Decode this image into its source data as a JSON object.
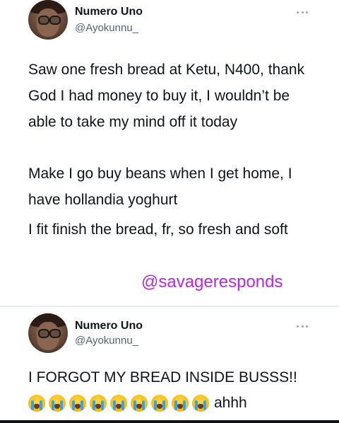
{
  "tweet1": {
    "author_name": "Numero Uno",
    "author_handle": "@Ayokunnu_",
    "paragraphs": [
      "Saw one fresh bread at Ketu, N400, thank God I had money to buy it, I wouldn’t be able to take my mind off it today",
      "Make I go buy beans when I get home, I have hollandia yoghurt",
      "I fit finish the bread, fr, so fresh and soft"
    ],
    "more_icon": "more-horizontal-icon"
  },
  "watermark": {
    "text": "@savageresponds",
    "color": "#b62adf"
  },
  "tweet2": {
    "author_name": "Numero Uno",
    "author_handle": "@Ayokunnu_",
    "text": "I FORGOT MY BREAD INSIDE BUSSS!!",
    "emoji_name": "loudly-crying-face-emoji",
    "emoji_count": 9,
    "trailing_text": "ahhh",
    "more_icon": "more-horizontal-icon"
  },
  "colors": {
    "text_primary": "#0f1419",
    "text_secondary": "#536471"
  }
}
